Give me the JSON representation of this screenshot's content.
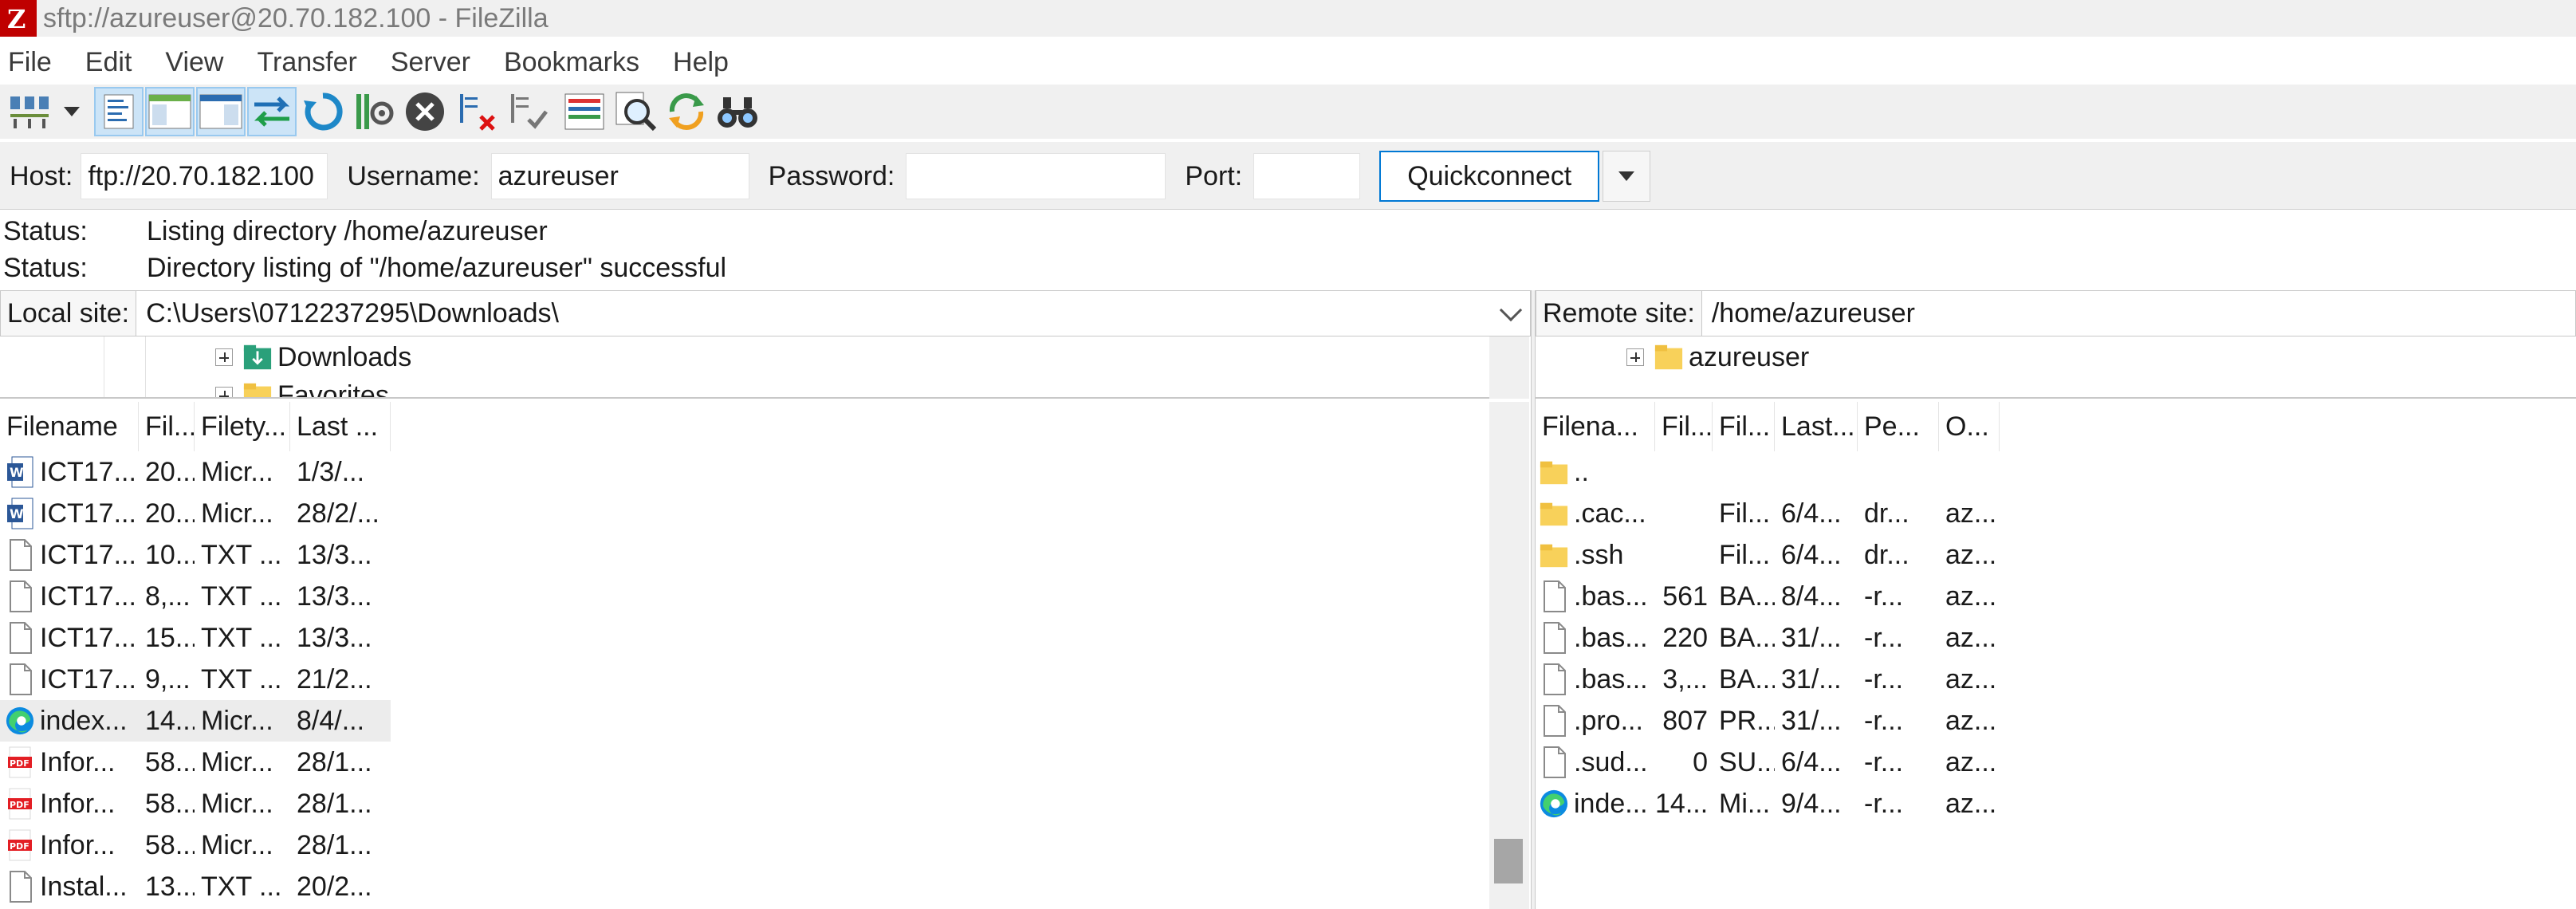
{
  "window": {
    "title": "sftp://azureuser@20.70.182.100 - FileZilla",
    "app_icon": "FZ"
  },
  "menu": [
    "File",
    "Edit",
    "View",
    "Transfer",
    "Server",
    "Bookmarks",
    "Help"
  ],
  "toolbar": {
    "icons": [
      "site-manager-icon",
      "toggle-message-log-icon",
      "toggle-local-tree-icon",
      "toggle-remote-tree-icon",
      "toggle-transfer-queue-icon",
      "refresh-icon",
      "process-queue-icon",
      "cancel-icon",
      "disconnect-icon",
      "reconnect-icon",
      "directory-listing-filters-icon",
      "search-remote-files-icon",
      "synchronized-browsing-icon",
      "find-files-icon"
    ]
  },
  "quickconnect": {
    "host_label": "Host:",
    "host_value": "ftp://20.70.182.100",
    "username_label": "Username:",
    "username_value": "azureuser",
    "password_label": "Password:",
    "password_value": "",
    "port_label": "Port:",
    "port_value": "",
    "button_label": "Quickconnect"
  },
  "status_log": [
    {
      "key": "Status:",
      "message": "Listing directory /home/azureuser"
    },
    {
      "key": "Status:",
      "message": "Directory listing of \"/home/azureuser\" successful"
    }
  ],
  "local": {
    "site_label": "Local site:",
    "path": "C:\\Users\\0712237295\\Downloads\\",
    "tree": [
      {
        "name": "Downloads",
        "icon": "downloads-folder-icon"
      },
      {
        "name": "Favorites",
        "icon": "folder-icon"
      }
    ],
    "columns": [
      "Filename",
      "Fil...",
      "Filety...",
      "Last ..."
    ],
    "files": [
      {
        "name": "ICT17...",
        "size": "20...",
        "type": "Micr...",
        "modified": "1/3/...",
        "icon": "word-doc-icon"
      },
      {
        "name": "ICT17...",
        "size": "20...",
        "type": "Micr...",
        "modified": "28/2/...",
        "icon": "word-doc-icon"
      },
      {
        "name": "ICT17...",
        "size": "10...",
        "type": "TXT ...",
        "modified": "13/3...",
        "icon": "text-file-icon"
      },
      {
        "name": "ICT17...",
        "size": "8,...",
        "type": "TXT ...",
        "modified": "13/3...",
        "icon": "text-file-icon"
      },
      {
        "name": "ICT17...",
        "size": "15...",
        "type": "TXT ...",
        "modified": "13/3...",
        "icon": "text-file-icon"
      },
      {
        "name": "ICT17...",
        "size": "9,...",
        "type": "TXT ...",
        "modified": "21/2...",
        "icon": "text-file-icon"
      },
      {
        "name": "index...",
        "size": "14...",
        "type": "Micr...",
        "modified": "8/4/...",
        "icon": "edge-html-icon",
        "selected": true
      },
      {
        "name": "Infor...",
        "size": "58...",
        "type": "Micr...",
        "modified": "28/1...",
        "icon": "pdf-file-icon"
      },
      {
        "name": "Infor...",
        "size": "58...",
        "type": "Micr...",
        "modified": "28/1...",
        "icon": "pdf-file-icon"
      },
      {
        "name": "Infor...",
        "size": "58...",
        "type": "Micr...",
        "modified": "28/1...",
        "icon": "pdf-file-icon"
      },
      {
        "name": "Instal...",
        "size": "13...",
        "type": "TXT ...",
        "modified": "20/2...",
        "icon": "text-file-icon"
      }
    ]
  },
  "remote": {
    "site_label": "Remote site:",
    "path": "/home/azureuser",
    "tree": [
      {
        "name": "azureuser",
        "icon": "folder-icon"
      }
    ],
    "columns": [
      "Filena...",
      "Fil...",
      "Fil...",
      "Last...",
      "Pe...",
      "O..."
    ],
    "files": [
      {
        "name": "..",
        "size": "",
        "type": "",
        "modified": "",
        "perms": "",
        "owner": "",
        "icon": "folder-icon"
      },
      {
        "name": ".cac...",
        "size": "",
        "type": "Fil...",
        "modified": "6/4...",
        "perms": "dr...",
        "owner": "az...",
        "icon": "folder-icon"
      },
      {
        "name": ".ssh",
        "size": "",
        "type": "Fil...",
        "modified": "6/4...",
        "perms": "dr...",
        "owner": "az...",
        "icon": "folder-icon"
      },
      {
        "name": ".bas...",
        "size": "561",
        "type": "BA...",
        "modified": "8/4...",
        "perms": "-r...",
        "owner": "az...",
        "icon": "text-file-icon"
      },
      {
        "name": ".bas...",
        "size": "220",
        "type": "BA...",
        "modified": "31/...",
        "perms": "-r...",
        "owner": "az...",
        "icon": "text-file-icon"
      },
      {
        "name": ".bas...",
        "size": "3,...",
        "type": "BA...",
        "modified": "31/...",
        "perms": "-r...",
        "owner": "az...",
        "icon": "text-file-icon"
      },
      {
        "name": ".pro...",
        "size": "807",
        "type": "PR...",
        "modified": "31/...",
        "perms": "-r...",
        "owner": "az...",
        "icon": "text-file-icon"
      },
      {
        "name": ".sud...",
        "size": "0",
        "type": "SU...",
        "modified": "6/4...",
        "perms": "-r...",
        "owner": "az...",
        "icon": "text-file-icon"
      },
      {
        "name": "inde...",
        "size": "14...",
        "type": "Mi...",
        "modified": "9/4...",
        "perms": "-r...",
        "owner": "az...",
        "icon": "edge-html-icon"
      }
    ]
  }
}
